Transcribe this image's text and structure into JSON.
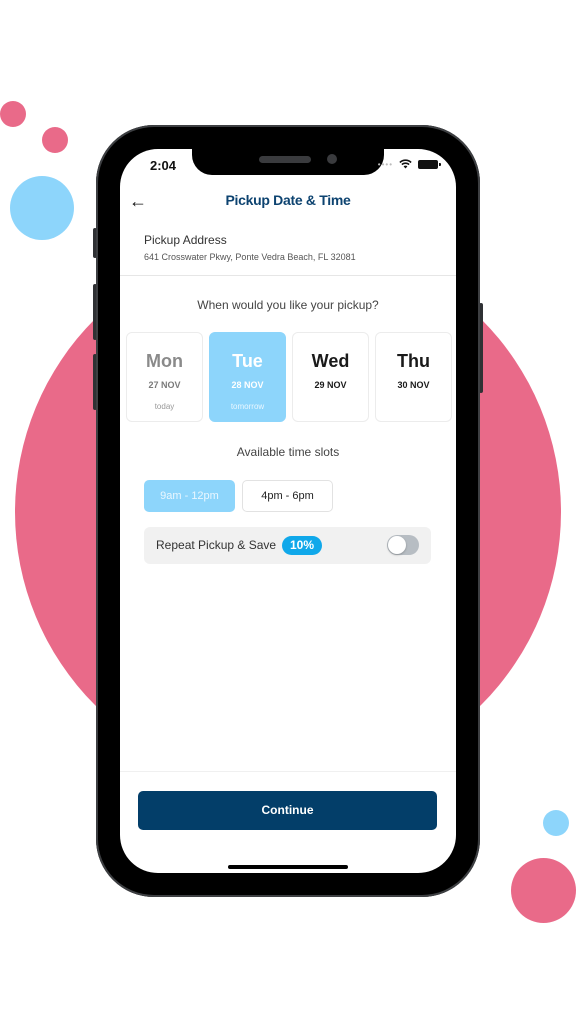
{
  "colors": {
    "accent_pink": "#e96a89",
    "accent_light_blue": "#8dd5fb",
    "title_navy": "#0d4370",
    "primary_button": "#033e69",
    "badge_blue": "#10a8ea"
  },
  "status_bar": {
    "time": "2:04",
    "icons": [
      "signal-dots-icon",
      "wifi-icon",
      "battery-icon"
    ]
  },
  "header": {
    "back_icon": "arrow-left-icon",
    "back_glyph": "←",
    "title": "Pickup Date & Time"
  },
  "address": {
    "label": "Pickup Address",
    "value": "641 Crosswater Pkwy, Ponte Vedra Beach, FL 32081"
  },
  "date_picker": {
    "prompt": "When would you like your pickup?",
    "days": [
      {
        "name": "Mon",
        "date": "27 NOV",
        "sub": "today",
        "state": "past"
      },
      {
        "name": "Tue",
        "date": "28 NOV",
        "sub": "tomorrow",
        "state": "selected"
      },
      {
        "name": "Wed",
        "date": "29 NOV",
        "sub": "",
        "state": "available"
      },
      {
        "name": "Thu",
        "date": "30 NOV",
        "sub": "",
        "state": "available"
      }
    ]
  },
  "time_slots": {
    "label": "Available time slots",
    "slots": [
      {
        "label": "9am - 12pm",
        "selected": true
      },
      {
        "label": "4pm - 6pm",
        "selected": false
      }
    ]
  },
  "repeat": {
    "label": "Repeat Pickup & Save",
    "badge": "10%",
    "enabled": false
  },
  "footer": {
    "continue_label": "Continue"
  }
}
